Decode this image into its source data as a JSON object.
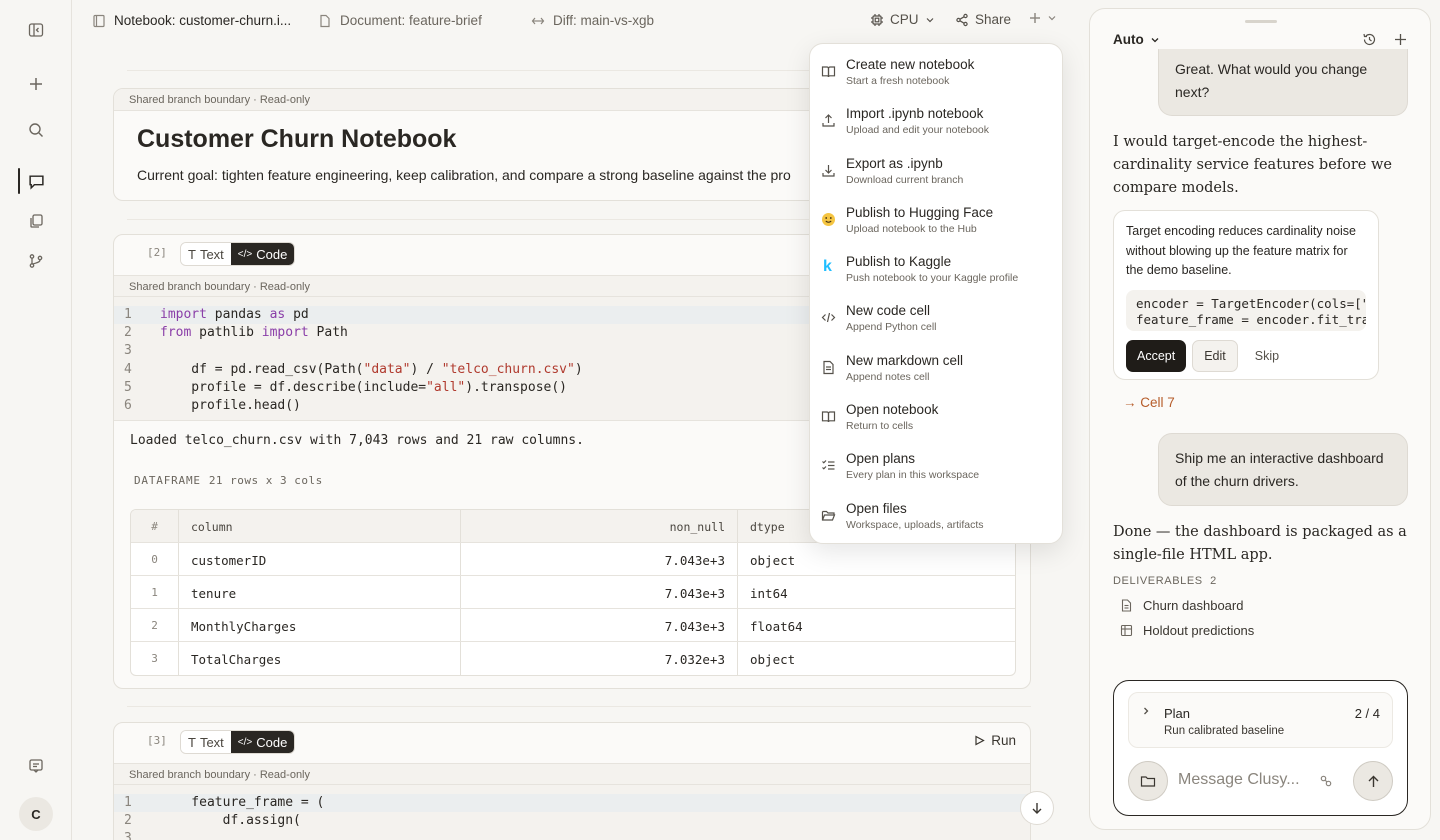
{
  "tabs": [
    {
      "label": "Notebook: customer-churn.i...",
      "icon": "notebook-icon"
    },
    {
      "label": "Document: feature-brief",
      "icon": "document-icon"
    },
    {
      "label": "Diff: main-vs-xgb",
      "icon": "diff-icon"
    }
  ],
  "toolbar": {
    "runtime": "CPU",
    "share": "Share"
  },
  "notebook": {
    "boundary_label": "Shared branch boundary · Read-only",
    "title": "Customer Churn Notebook",
    "goal": "Current goal: tighten feature engineering, keep calibration, and compare a strong baseline against the pro",
    "cells": [
      {
        "exec": "[2]",
        "modes": {
          "text": "Text",
          "code": "Code"
        },
        "output": "Loaded telco_churn.csv with 7,043 rows and 21 raw columns.",
        "dataframe": {
          "label": "DATAFRAME",
          "shape": "21 rows x 3 cols",
          "headers": [
            "#",
            "column",
            "non_null",
            "dtype"
          ],
          "rows": [
            [
              "0",
              "customerID",
              "7.043e+3",
              "object"
            ],
            [
              "1",
              "tenure",
              "7.043e+3",
              "int64"
            ],
            [
              "2",
              "MonthlyCharges",
              "7.043e+3",
              "float64"
            ],
            [
              "3",
              "TotalCharges",
              "7.032e+3",
              "object"
            ]
          ]
        }
      },
      {
        "exec": "[3]",
        "modes": {
          "text": "Text",
          "code": "Code"
        },
        "run": "Run"
      }
    ]
  },
  "menu": {
    "items": [
      {
        "title": "Create new notebook",
        "sub": "Start a fresh notebook",
        "icon": "book-open-icon"
      },
      {
        "title": "Import .ipynb notebook",
        "sub": "Upload and edit your notebook",
        "icon": "upload-icon"
      },
      {
        "title": "Export as .ipynb",
        "sub": "Download current branch",
        "icon": "download-icon"
      },
      {
        "title": "Publish to Hugging Face",
        "sub": "Upload notebook to the Hub",
        "icon": "hugging-face-icon"
      },
      {
        "title": "Publish to Kaggle",
        "sub": "Push notebook to your Kaggle profile",
        "icon": "kaggle-icon"
      },
      {
        "title": "New code cell",
        "sub": "Append Python cell",
        "icon": "code-icon"
      },
      {
        "title": "New markdown cell",
        "sub": "Append notes cell",
        "icon": "file-text-icon"
      },
      {
        "title": "Open notebook",
        "sub": "Return to cells",
        "icon": "book-open-icon"
      },
      {
        "title": "Open plans",
        "sub": "Every plan in this workspace",
        "icon": "checklist-icon"
      },
      {
        "title": "Open files",
        "sub": "Workspace, uploads, artifacts",
        "icon": "folder-open-icon"
      }
    ]
  },
  "chat": {
    "mode": "Auto",
    "user_msg_1": "Great. What would you change next?",
    "assistant_msg_1": "I would target-encode the highest-cardinality service features before we compare models.",
    "suggestion": {
      "text": "Target encoding reduces cardinality noise without blowing up the feature matrix for the demo baseline.",
      "accept": "Accept",
      "edit": "Edit",
      "skip": "Skip"
    },
    "cell_link": "→ Cell 7",
    "user_msg_2": "Ship me an interactive dashboard of the churn drivers.",
    "assistant_msg_2": "Done — the dashboard is packaged as a single-file HTML app.",
    "deliverables_label": "DELIVERABLES",
    "deliverables_count": "2",
    "deliverables": [
      {
        "label": "Churn dashboard",
        "icon": "file-icon"
      },
      {
        "label": "Holdout predictions",
        "icon": "table-icon"
      }
    ],
    "plan": {
      "title": "Plan",
      "sub": "Run calibrated baseline",
      "count": "2 / 4"
    },
    "composer_placeholder": "Message Clusy..."
  },
  "user": {
    "initial": "C"
  },
  "colors": {
    "accent_dark": "#2a2723",
    "link": "#b65c2a",
    "keyword": "#8a3ea8",
    "string": "#b03a2e"
  }
}
